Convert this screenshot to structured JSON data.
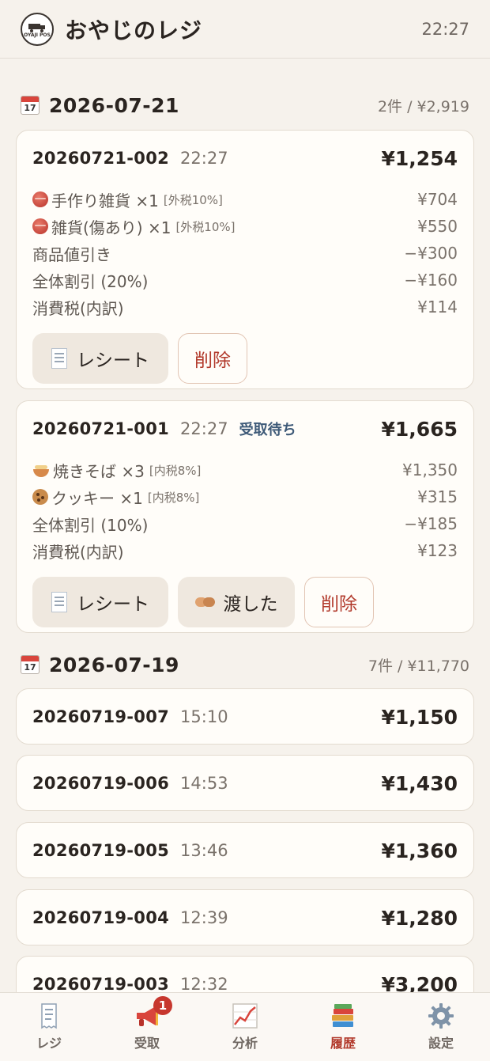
{
  "header": {
    "title": "おやじのレジ",
    "time": "22:27",
    "logo_text": "OYAJI POS"
  },
  "days": [
    {
      "date": "2026-07-21",
      "summary": "2件 / ¥2,919",
      "calendar_day": "17",
      "receipts": [
        {
          "id": "20260721-002",
          "time": "22:27",
          "status": "",
          "total": "¥1,254",
          "lines": [
            {
              "icon": "yarn-icon",
              "label": "手作り雑貨 ×1",
              "tag": "[外税10%]",
              "amount": "¥704"
            },
            {
              "icon": "yarn-icon",
              "label": "雑貨(傷あり) ×1",
              "tag": "[外税10%]",
              "amount": "¥550"
            },
            {
              "icon": "",
              "label": "商品値引き",
              "tag": "",
              "amount": "−¥300"
            },
            {
              "icon": "",
              "label": "全体割引 (20%)",
              "tag": "",
              "amount": "−¥160"
            },
            {
              "icon": "",
              "label": "消費税(内訳)",
              "tag": "",
              "amount": "¥114"
            }
          ],
          "buttons": {
            "receipt": "レシート",
            "delete": "削除"
          }
        },
        {
          "id": "20260721-001",
          "time": "22:27",
          "status": "受取待ち",
          "total": "¥1,665",
          "lines": [
            {
              "icon": "noodle-icon",
              "label": "焼きそば ×3",
              "tag": "[内税8%]",
              "amount": "¥1,350"
            },
            {
              "icon": "cookie-icon",
              "label": "クッキー ×1",
              "tag": "[内税8%]",
              "amount": "¥315"
            },
            {
              "icon": "",
              "label": "全体割引 (10%)",
              "tag": "",
              "amount": "−¥185"
            },
            {
              "icon": "",
              "label": "消費税(内訳)",
              "tag": "",
              "amount": "¥123"
            }
          ],
          "buttons": {
            "receipt": "レシート",
            "handed": "渡した",
            "delete": "削除"
          }
        }
      ]
    },
    {
      "date": "2026-07-19",
      "summary": "7件 / ¥11,770",
      "calendar_day": "17",
      "receipts": [
        {
          "id": "20260719-007",
          "time": "15:10",
          "total": "¥1,150"
        },
        {
          "id": "20260719-006",
          "time": "14:53",
          "total": "¥1,430"
        },
        {
          "id": "20260719-005",
          "time": "13:46",
          "total": "¥1,360"
        },
        {
          "id": "20260719-004",
          "time": "12:39",
          "total": "¥1,280"
        },
        {
          "id": "20260719-003",
          "time": "12:32",
          "total": "¥3,200"
        }
      ]
    }
  ],
  "nav": [
    {
      "label": "レジ",
      "icon": "receipt-icon",
      "active": false
    },
    {
      "label": "受取",
      "icon": "megaphone-icon",
      "active": false,
      "badge": "1"
    },
    {
      "label": "分析",
      "icon": "chart-icon",
      "active": false
    },
    {
      "label": "履歴",
      "icon": "books-icon",
      "active": true
    },
    {
      "label": "設定",
      "icon": "gear-icon",
      "active": false
    }
  ],
  "colors": {
    "accent": "#b23a2c",
    "background": "#f6f2ec",
    "status": "#3e5a78"
  }
}
